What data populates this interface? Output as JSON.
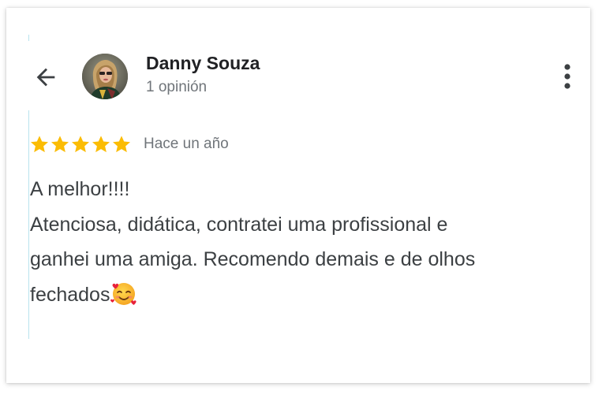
{
  "review": {
    "author": {
      "name": "Danny Souza",
      "review_count": "1 opinión"
    },
    "rating": 5,
    "date": "Hace un año",
    "text_lines": [
      "A melhor!!!!",
      "Atenciosa, didática, contratei uma profissional e",
      "ganhei uma amiga. Recomendo demais e de olhos",
      "fechados"
    ],
    "trailing_emoji": "smiling-face-with-hearts"
  },
  "icons": {
    "back": "arrow-left-icon",
    "menu": "more-vert-icon",
    "star": "star-icon"
  },
  "colors": {
    "star": "#fbbc04",
    "name": "#202124",
    "secondary": "#70757a",
    "body": "#3c4043",
    "guide_line": "#b9e3ee"
  }
}
